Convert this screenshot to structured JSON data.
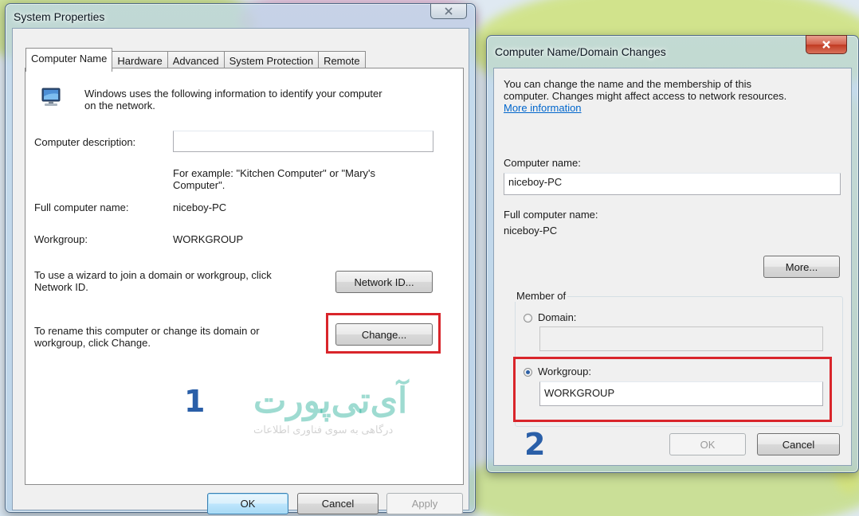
{
  "system_properties": {
    "title": "System Properties",
    "tabs": [
      "Computer Name",
      "Hardware",
      "Advanced",
      "System Protection",
      "Remote"
    ],
    "active_tab": "Computer Name",
    "intro_text_line1": "Windows uses the following information to identify your computer",
    "intro_text_line2": "on the network.",
    "description_label": "Computer description:",
    "description_value": "",
    "example_line1": "For example: \"Kitchen Computer\" or \"Mary's",
    "example_line2": "Computer\".",
    "full_name_label": "Full computer name:",
    "full_name_value": "niceboy-PC",
    "workgroup_label": "Workgroup:",
    "workgroup_value": "WORKGROUP",
    "wizard_text_line1": "To use a wizard to join a domain or workgroup, click",
    "wizard_text_line2": "Network ID.",
    "network_id_button": "Network ID...",
    "rename_text_line1": "To rename this computer or change its domain or",
    "rename_text_line2": "workgroup, click Change.",
    "change_button": "Change...",
    "ok_button": "OK",
    "cancel_button": "Cancel",
    "apply_button": "Apply"
  },
  "name_changes": {
    "title": "Computer Name/Domain Changes",
    "intro_line1": "You can change the name and the membership of this",
    "intro_line2": "computer. Changes might affect access to network resources.",
    "more_info_link": "More information",
    "computer_name_label": "Computer name:",
    "computer_name_value": "niceboy-PC",
    "full_name_label": "Full computer name:",
    "full_name_value": "niceboy-PC",
    "more_button": "More...",
    "member_of_label": "Member of",
    "domain_label": "Domain:",
    "domain_value": "",
    "workgroup_label": "Workgroup:",
    "workgroup_value": "WORKGROUP",
    "selected_membership": "Workgroup",
    "ok_button": "OK",
    "cancel_button": "Cancel"
  },
  "annotations": {
    "step1": "1",
    "step2": "2",
    "highlight_color": "#d9252b",
    "step_color": "#2a5fa8"
  },
  "watermark": {
    "title": "آی‌تی‌پورت",
    "subtitle": "درگاهی به سوی فناوری اطلاعات"
  }
}
